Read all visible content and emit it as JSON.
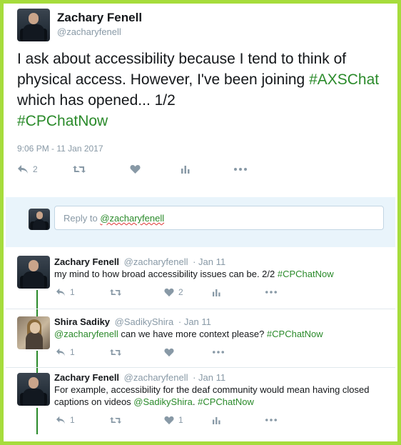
{
  "main_tweet": {
    "name": "Zachary Fenell",
    "handle": "@zacharyfenell",
    "text_plain": "I ask about accessibility because I tend to think of physical access. However, I've been joining ",
    "hashtag1": "#AXSChat",
    "text_mid": " which has opened... 1/2",
    "hashtag2": "#CPChatNow",
    "timestamp": "9:06 PM - 11 Jan 2017",
    "reply_count": "2"
  },
  "reply_box": {
    "prefix": "Reply to ",
    "mention": "@zacharyfenell"
  },
  "thread": [
    {
      "name": "Zachary Fenell",
      "handle": "@zacharyfenell",
      "date": "· Jan 11",
      "text": "my mind to how broad accessibility issues can be. 2/2 ",
      "tag": "#CPChatNow",
      "reply_count": "1",
      "like_count": "2"
    },
    {
      "name": "Shira Sadiky",
      "handle": "@SadikyShira",
      "date": "· Jan 11",
      "mention": "@zacharyfenell",
      "text": " can we have more context please? ",
      "tag": "#CPChatNow",
      "reply_count": "1",
      "like_count": ""
    },
    {
      "name": "Zachary Fenell",
      "handle": "@zacharyfenell",
      "date": "· Jan 11",
      "text_line1": "For example, accessibility for the deaf community would mean having closed",
      "text_line2": "captions on videos ",
      "mention": "@SadikyShira",
      "text_after": ". ",
      "tag": "#CPChatNow",
      "reply_count": "1",
      "like_count": "1"
    }
  ],
  "colors": {
    "hashtag": "#2a8a2a",
    "frame": "#a6dc3c",
    "muted": "#8899a6",
    "reply_bg": "#e9f4fb"
  },
  "icons": [
    "reply-icon",
    "retweet-icon",
    "heart-icon",
    "analytics-icon",
    "more-icon"
  ]
}
